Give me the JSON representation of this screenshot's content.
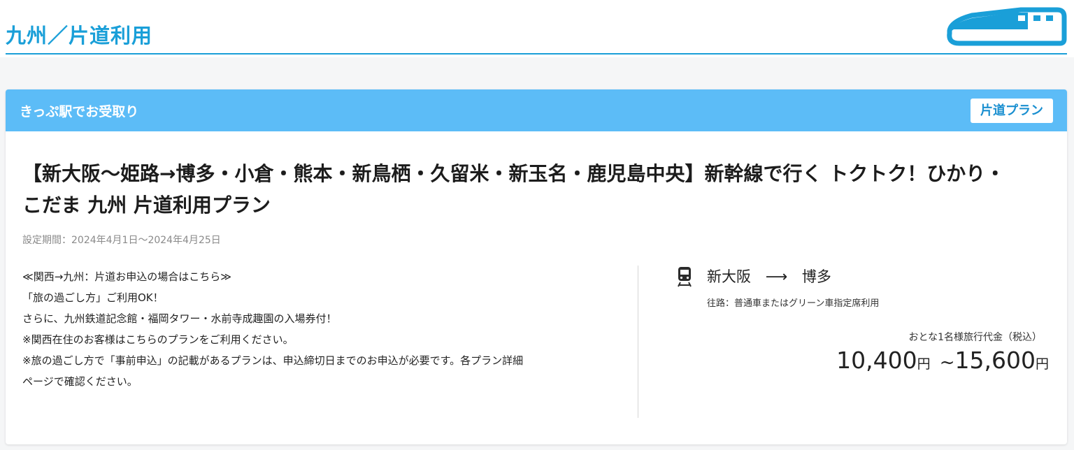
{
  "header": {
    "title": "九州／片道利用",
    "brand_color": "#1a9fd8"
  },
  "card": {
    "header_label": "きっぷ駅でお受取り",
    "header_color": "#5cbcf7",
    "badge": "片道プラン",
    "title": "【新大阪〜姫路→博多・小倉・熊本・新鳥栖・久留米・新玉名・鹿児島中央】新幹線で行く トクトク！ひかり・こだま 九州 片道利用プラン",
    "period": "設定期間：2024年4月1日〜2024年4月25日",
    "description": [
      "≪関西→九州：片道お申込の場合はこちら≫",
      "「旅の過ごし方」ご利用OK！",
      "さらに、九州鉄道記念館・福岡タワー・水前寺成趣園の入場券付！",
      "※関西在住のお客様はこちらのプランをご利用ください。",
      "※旅の過ごし方で「事前申込」の記載があるプランは、申込締切日までのお申込が必要です。各プラン詳細",
      "ページで確認ください。"
    ],
    "route": {
      "icon": "train-icon",
      "from": "新大阪",
      "arrow": "⟶",
      "to": "博多",
      "note": "往路：普通車またはグリーン車指定席利用"
    },
    "price": {
      "label": "おとな1名様旅行代金（税込）",
      "min": "10,400",
      "max": "15,600",
      "unit": "円",
      "tilde": "~"
    }
  }
}
